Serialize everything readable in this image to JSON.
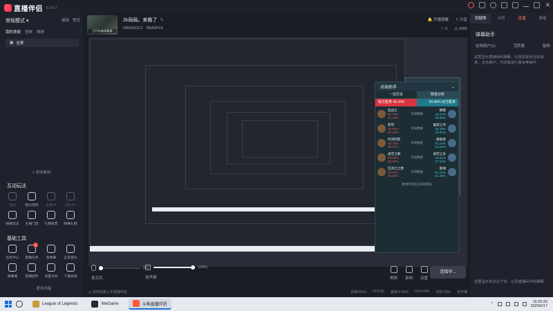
{
  "app": {
    "name": "直播伴侣",
    "version": "6.4.6.2"
  },
  "titlebar_icons": [
    "pin-icon",
    "bell-icon",
    "headset-icon",
    "fullscreen-icon",
    "menu-icon"
  ],
  "sidebar": {
    "mode": "常规模式",
    "actions": [
      "编辑",
      "预览"
    ],
    "scene_tabs": [
      "我的场景",
      "竖屏",
      "横屏"
    ],
    "scene_item": "全屏",
    "add_material": "+ 添加素材",
    "interactive_title": "互动玩法",
    "interactive_tools": [
      {
        "label": "连线",
        "dim": true
      },
      {
        "label": "观众连线",
        "dim": false
      },
      {
        "label": "主播PK",
        "dim": true
      },
      {
        "label": "观众PK",
        "dim": true
      },
      {
        "label": "弹幕玩法",
        "dim": false
      },
      {
        "label": "主播门店",
        "dim": false
      },
      {
        "label": "礼物投票",
        "dim": false
      },
      {
        "label": "弹幕礼物",
        "dim": false
      }
    ],
    "basic_title": "基础工具",
    "basic_tools": [
      {
        "label": "任务中心",
        "badge": ""
      },
      {
        "label": "直播任务",
        "badge": "1"
      },
      {
        "label": "发弹幕",
        "badge": ""
      },
      {
        "label": "正常音乐",
        "badge": ""
      },
      {
        "label": "弹幕墙",
        "badge": ""
      },
      {
        "label": "直播挂件",
        "badge": ""
      },
      {
        "label": "流量分析",
        "badge": ""
      },
      {
        "label": "下播总结",
        "badge": ""
      }
    ],
    "more_label": "··· 更多功能"
  },
  "room": {
    "cover_label": "已开启画面截取",
    "title": "2k局局。来晚了",
    "category": "NBA2KOL2",
    "category_tag": "NBA2KOL",
    "actions": [
      "开播提醒",
      "分享"
    ],
    "stats": [
      "0",
      "3086"
    ]
  },
  "overlay": {
    "title": "对局助手",
    "tabs": [
      "一键配置",
      "阵容分析"
    ],
    "our_label": "我方胜率",
    "our_rate": "49.34%",
    "their_rate": "50.66%",
    "their_label": "对方胜率",
    "matchups": [
      {
        "l_name": "狂战士",
        "l_pct": "50.73%",
        "l_pct2": "51.44%",
        "mid": "对局数据",
        "r_name": "狮鹫",
        "r_pct": "49.27%",
        "r_pct2": "48.56%"
      },
      {
        "l_name": "影哥",
        "l_pct": "46.51%",
        "l_pct2": "51.19%",
        "mid": "对局数据",
        "r_name": "幽冥之牙",
        "r_pct": "53.49%",
        "r_pct2": "48.81%"
      },
      {
        "l_name": "时间刺客",
        "l_pct": "48.76%",
        "l_pct2": "48.07%",
        "mid": "对局数据",
        "r_name": "解脱者",
        "r_pct": "51.24%",
        "r_pct2": "51.93%"
      },
      {
        "l_name": "虚空之眼",
        "l_pct": "50.09%",
        "l_pct2": "52.84%",
        "mid": "对局数据",
        "r_name": "虚空之女",
        "r_pct": "49.91%",
        "r_pct2": "47.16%"
      },
      {
        "l_name": "瓦洛兰之盾",
        "l_pct": "48.76%",
        "l_pct2": "48.55%",
        "mid": "对局数据",
        "r_name": "狼魂",
        "r_pct": "51.24%",
        "r_pct2": "51.45%"
      }
    ],
    "footer": "助你可视化对局情况"
  },
  "audio": {
    "mic_label": "麦克风",
    "mic_value": "0%",
    "mic_level": 0,
    "speaker_label": "扬声器",
    "speaker_value": "100%",
    "speaker_level": 100,
    "controls": [
      "美颜",
      "录制",
      "设置"
    ],
    "connect_button": "连接中..."
  },
  "status": {
    "hint": "◎ 如何快速上手直播伴侣",
    "items": [
      "码率0Kb/s",
      "FPS:60",
      "丢帧 0.00%",
      "CPU:44%",
      "内存:26%",
      "未开播"
    ]
  },
  "right_panel": {
    "tabs": [
      "贡献榜",
      "小万",
      "直播",
      "评论"
    ],
    "helper_title": "弹幕助手",
    "subtabs": [
      "在线用户(1)",
      "活跃度",
      "贴粉"
    ],
    "note": "这里显示直播间的弹幕、礼物及其他互动消息，点击用户，可对其进行禁言等操作",
    "note_bottom": "这里显示未关注了你，以及直播间中的弹幕"
  },
  "taskbar": {
    "apps": [
      "League of Legends",
      "WeGame",
      "斗鱼直播伴侣"
    ],
    "time": "16:26:33",
    "date": "2025/6/17"
  }
}
